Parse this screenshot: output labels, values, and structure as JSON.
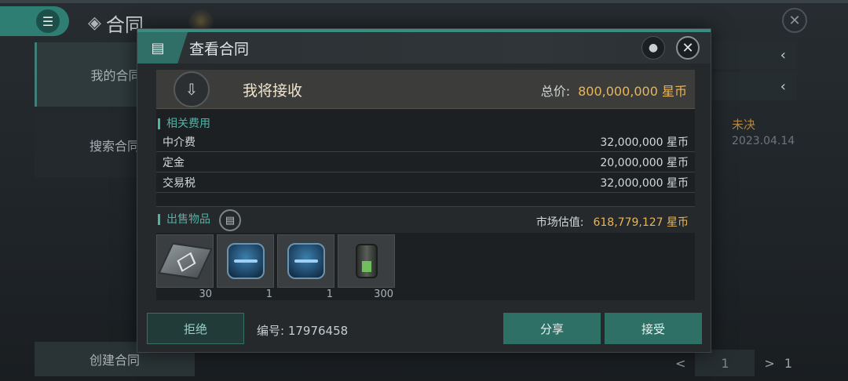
{
  "app": {
    "title": "合同",
    "menu_icon": "menu-icon",
    "close_icon": "close-icon"
  },
  "sidebar": {
    "items": [
      {
        "label": "我的合同"
      },
      {
        "label": "搜索合同"
      },
      {
        "label": "创建合同"
      }
    ]
  },
  "background_list": {
    "status": "未决",
    "date": "2023.04.14",
    "pager": {
      "prev": "<",
      "page": "1",
      "next": ">",
      "total": "1"
    }
  },
  "modal": {
    "title": "查看合同",
    "receive": {
      "label": "我将接收",
      "total_label": "总价:",
      "total_value": "800,000,000 星币"
    },
    "fees": {
      "section_title": "相关费用",
      "rows": [
        {
          "label": "中介费",
          "value": "32,000,000 星币"
        },
        {
          "label": "定金",
          "value": "20,000,000 星币"
        },
        {
          "label": "交易税",
          "value": "32,000,000 星币"
        }
      ]
    },
    "sale": {
      "section_title": "出售物品",
      "market_label": "市场估值:",
      "market_value": "618,779,127 星币",
      "items": [
        {
          "icon": "chip-icon",
          "qty": "30"
        },
        {
          "icon": "blueprint-icon",
          "qty": "1"
        },
        {
          "icon": "blueprint-icon",
          "qty": "1"
        },
        {
          "icon": "canister-icon",
          "qty": "300"
        }
      ]
    },
    "footer": {
      "reject": "拒绝",
      "contract_id": "编号: 17976458",
      "share": "分享",
      "accept": "接受"
    }
  },
  "colors": {
    "accent": "#2f7066",
    "gold": "#e8b55a",
    "teal_text": "#4fb3a6"
  }
}
